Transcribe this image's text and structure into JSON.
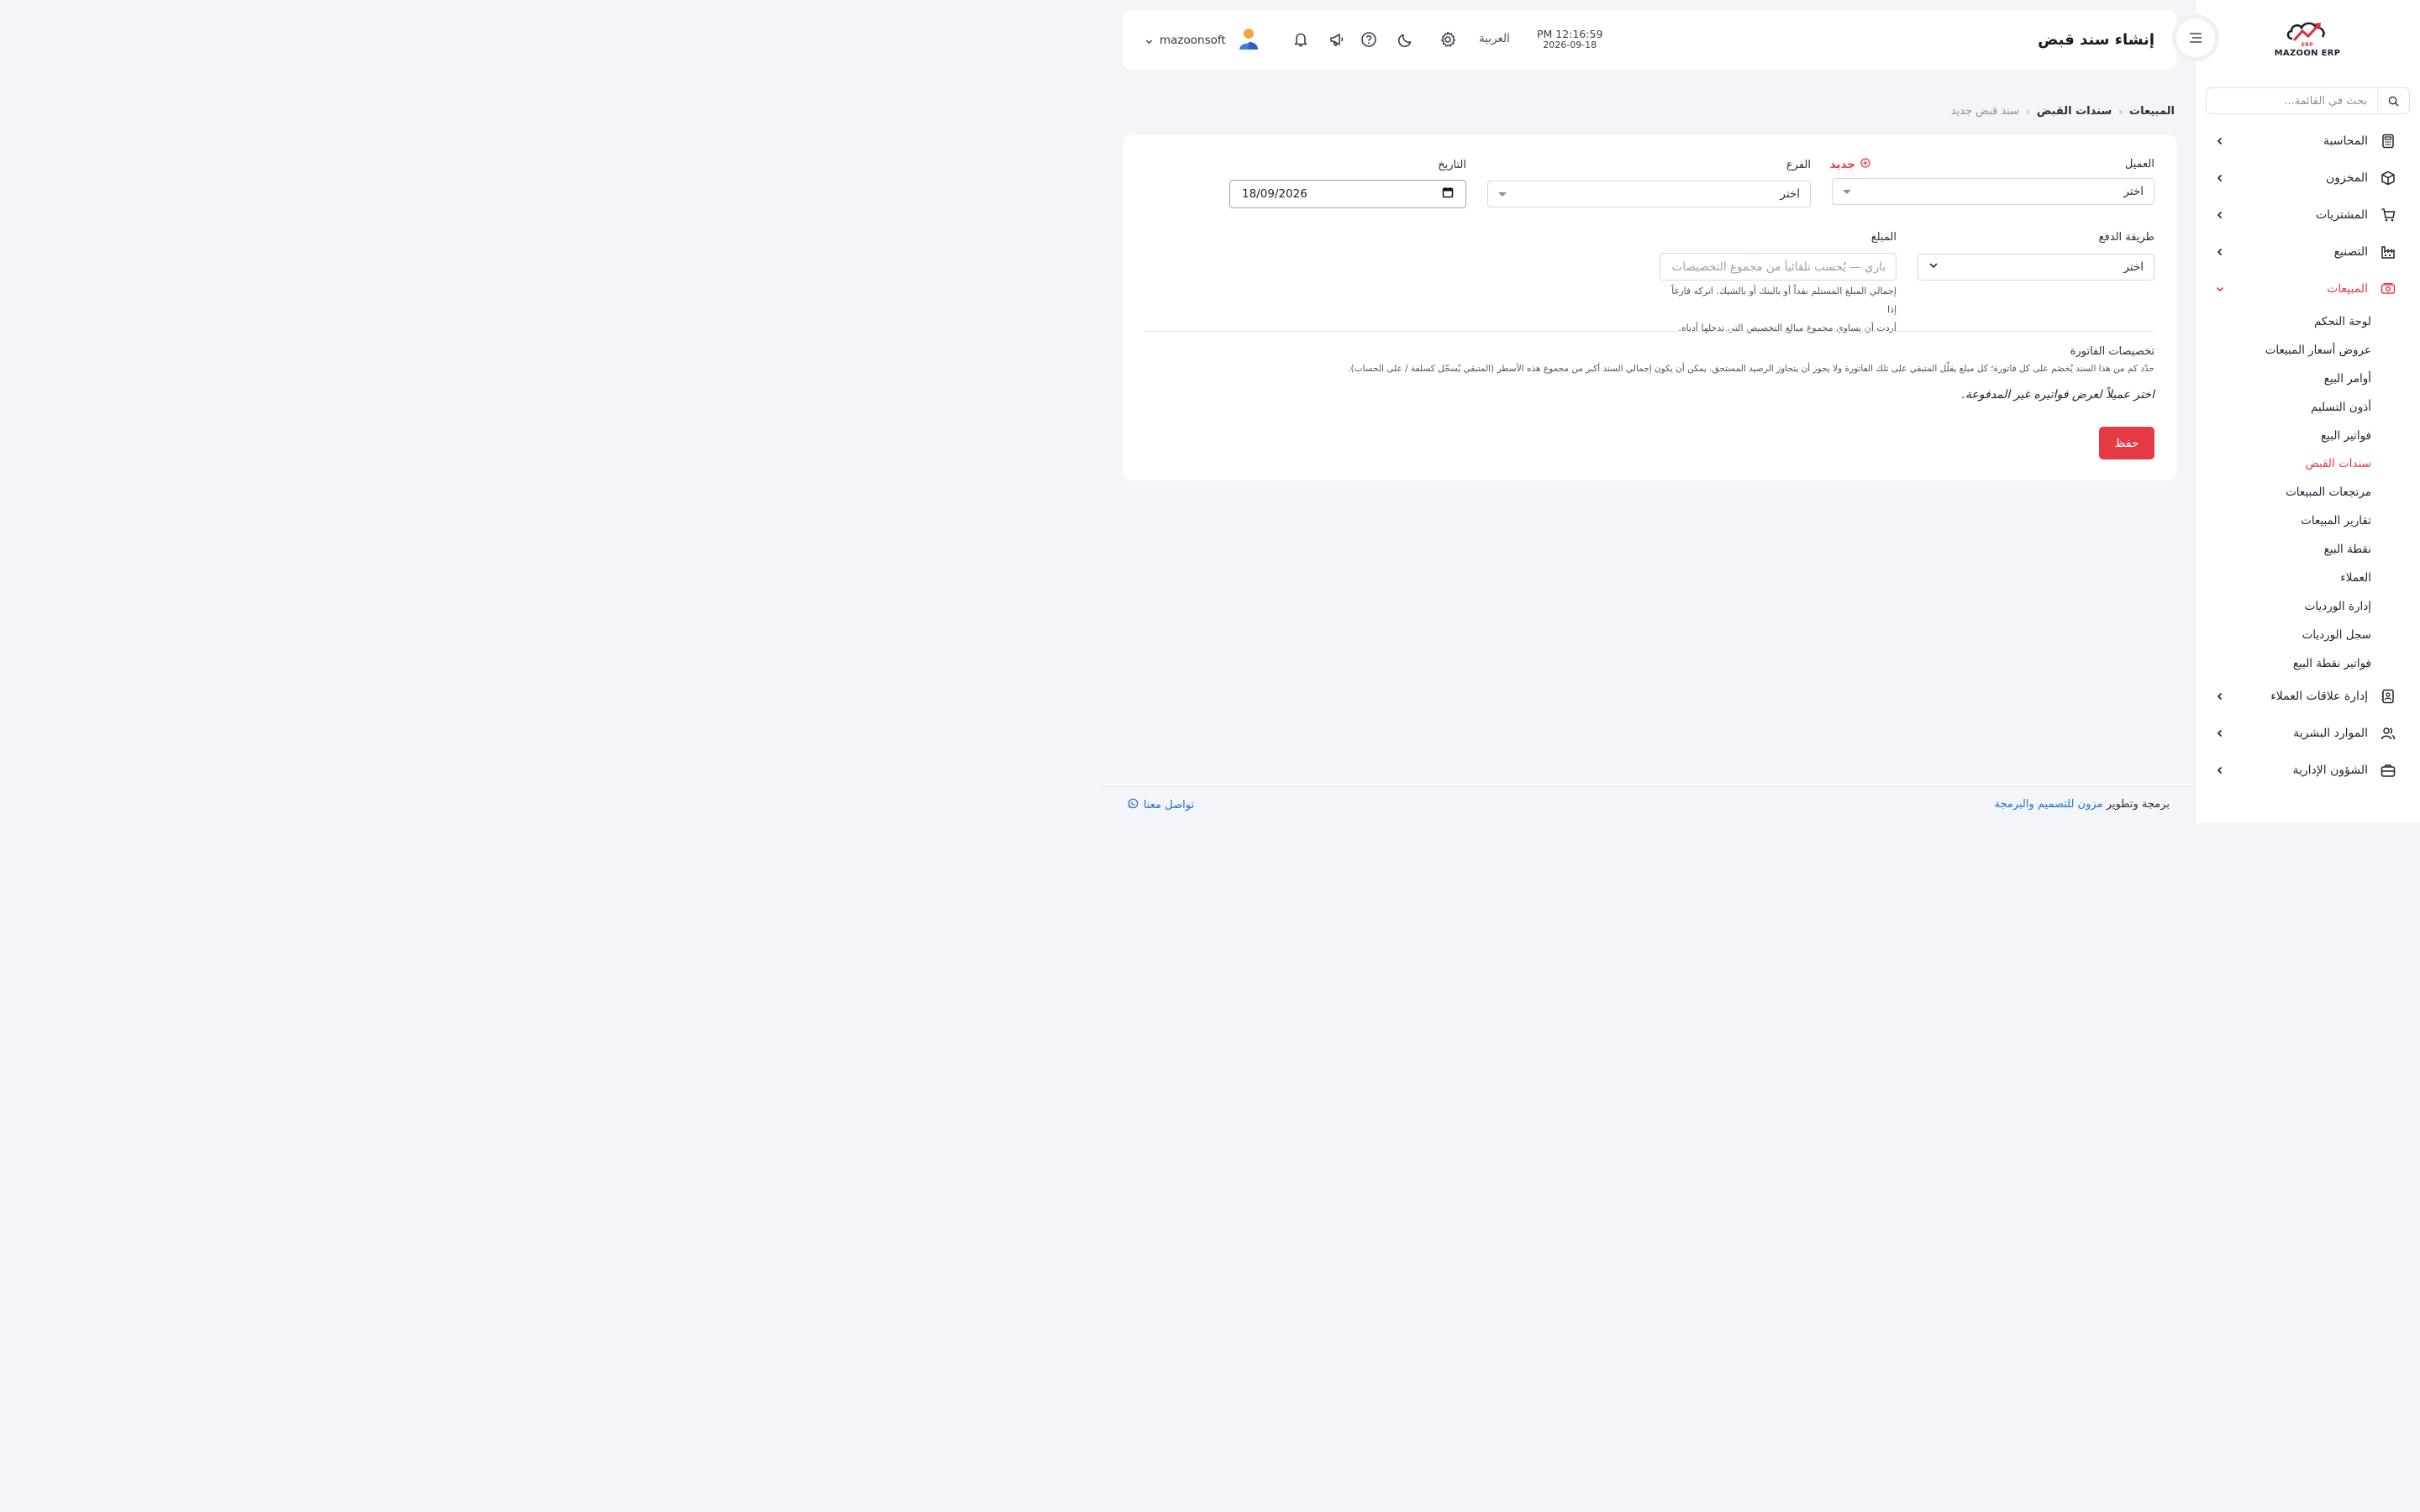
{
  "app": {
    "logo_sub": "ERP",
    "logo_name": "MAZOON ERP",
    "page_title": "إنشاء سند قبض"
  },
  "topbar": {
    "time": "PM 12:16:59",
    "date": "2026-09-18",
    "language": "العربية",
    "username": "mazoonsoft"
  },
  "sidebar": {
    "search_placeholder": "بحث في القائمة...",
    "items": [
      {
        "label": "المحاسبة",
        "icon": "calculator-icon"
      },
      {
        "label": "المخزون",
        "icon": "box-icon"
      },
      {
        "label": "المشتريات",
        "icon": "cart-icon"
      },
      {
        "label": "التصنيع",
        "icon": "factory-icon"
      },
      {
        "label": "المبيعات",
        "icon": "cash-icon",
        "active": true
      }
    ],
    "sales_sub": [
      "لوحة التحكم",
      "عروض أسعار المبيعات",
      "أوامر البيع",
      "أذون التسليم",
      "فواتير البيع",
      "سندات القبض",
      "مرتجعات المبيعات",
      "تقارير المبيعات",
      "نقطة البيع",
      "العملاء",
      "إدارة الورديات",
      "سجل الورديات",
      "فواتير نقطة البيع"
    ],
    "sales_sub_active": 5,
    "items_after": [
      {
        "label": "إدارة علاقات العملاء",
        "icon": "contacts-icon"
      },
      {
        "label": "الموارد البشرية",
        "icon": "users-icon"
      },
      {
        "label": "الشؤون الإدارية",
        "icon": "briefcase-icon"
      }
    ]
  },
  "breadcrumb": {
    "level1": "المبيعات",
    "level2": "سندات القبض",
    "current": "سند قبض جديد"
  },
  "form": {
    "customer_label": "العميل",
    "customer_value": "اختر",
    "new_link": "جديد",
    "branch_label": "الفرع",
    "branch_value": "اختر",
    "date_label": "التاريخ",
    "date_value": "18/09/2026",
    "payment_method_label": "طريقة الدفع",
    "payment_method_value": "اختر",
    "amount_label": "المبلغ",
    "amount_placeholder": "باري — يُحسب تلقائياً من مجموع التخصيصات",
    "amount_help_line1": "إجمالي المبلغ المستلم نقداً أو بالبنك أو بالشيك. اتركه فارغاً إذا",
    "amount_help_line2": "أردت أن يساوي مجموع مبالغ التخصيص التي تدخلها أدناه.",
    "allocations_title": "تخصيصات الفاتورة",
    "allocations_desc": "حدّد كم من هذا السند يُخصَم على كل فاتورة؛ كل مبلغ يقلّل المتبقي على تلك الفاتورة ولا يجوز أن يتجاوز الرصيد المستحق. يمكن أن يكون إجمالي السند أكبر من مجموع هذه الأسطر (المتبقي يُسجّل كسلفة / على الحساب).",
    "allocations_empty": "اختر عميلاً لعرض فواتيره غير المدفوعة.",
    "save_label": "حفظ"
  },
  "footer": {
    "credit_prefix": "برمجة وتطوير",
    "credit_brand": "مزون للتصميم والبرمجة",
    "contact": "تواصل معنا"
  },
  "colors": {
    "accent": "#e53946",
    "link": "#1e6fd9",
    "background": "#f3f5f8"
  }
}
